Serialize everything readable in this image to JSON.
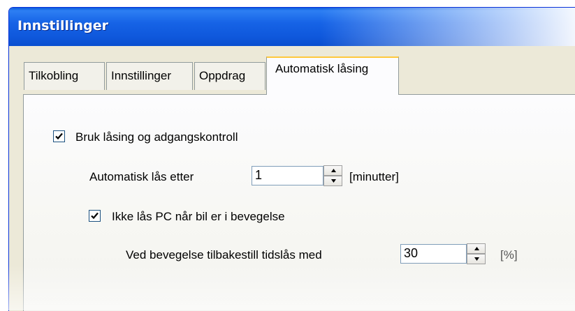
{
  "window": {
    "title": "Innstillinger"
  },
  "tabs": [
    {
      "label": "Tilkobling",
      "active": false
    },
    {
      "label": "Innstillinger",
      "active": false
    },
    {
      "label": "Oppdrag",
      "active": false
    },
    {
      "label": "Automatisk låsing",
      "active": true
    }
  ],
  "settings": {
    "use_locking": {
      "label": "Bruk låsing og adgangskontroll",
      "checked": true
    },
    "auto_lock": {
      "label": "Automatisk lås etter",
      "value": "1",
      "unit": "[minutter]"
    },
    "no_lock_moving": {
      "label": "Ikke lås PC når bil er i bevegelse",
      "checked": true
    },
    "reset_timer": {
      "label": "Ved bevegelse tilbakestill tidslås med",
      "value": "30",
      "unit": "[%]"
    }
  },
  "colors": {
    "titlebar": "#1663e6",
    "active_tab_accent": "#ffc83c",
    "checkmark": "#21a121"
  },
  "icons": [
    "checkmark-icon",
    "spin-up-arrow-icon",
    "spin-down-arrow-icon"
  ]
}
